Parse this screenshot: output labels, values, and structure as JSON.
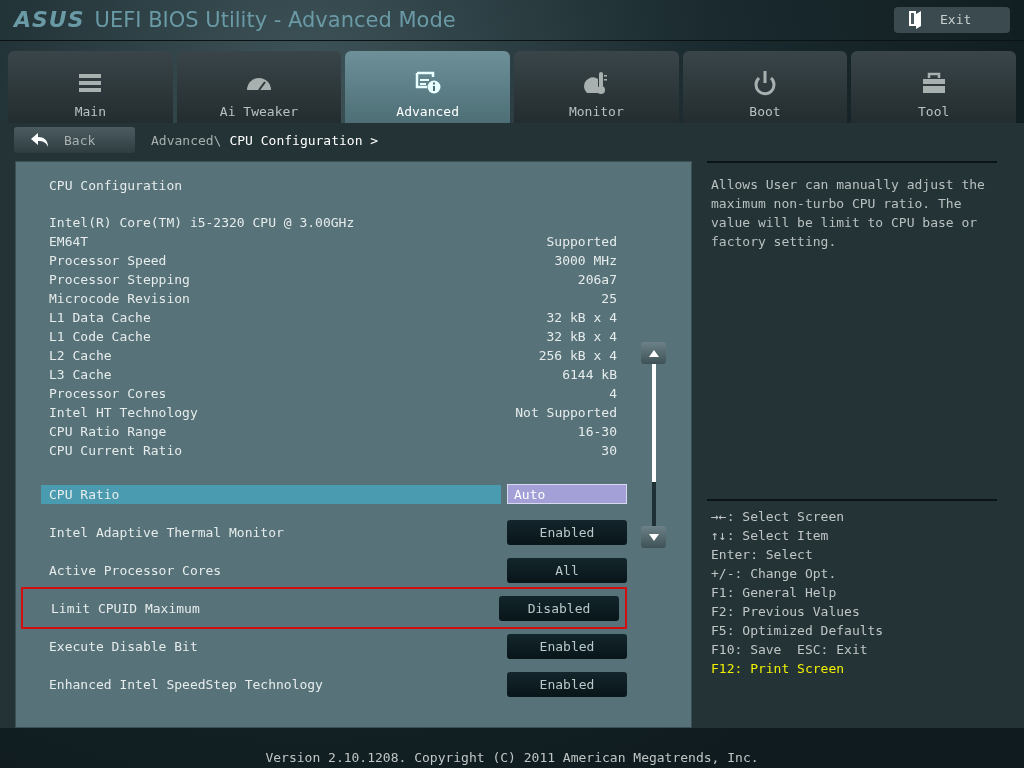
{
  "header": {
    "logo": "ASUS",
    "title": "UEFI BIOS Utility - Advanced Mode",
    "exit_button": "Exit"
  },
  "tabs": [
    {
      "label": "Main",
      "selected": false
    },
    {
      "label": "Ai Tweaker",
      "selected": false
    },
    {
      "label": "Advanced",
      "selected": true
    },
    {
      "label": "Monitor",
      "selected": false
    },
    {
      "label": "Boot",
      "selected": false
    },
    {
      "label": "Tool",
      "selected": false
    }
  ],
  "back_button": "Back",
  "breadcrumb": {
    "parent": "Advanced\\",
    "current": "CPU Configuration >"
  },
  "section_title": "CPU Configuration",
  "processor": "Intel(R) Core(TM) i5-2320 CPU @ 3.00GHz",
  "info_rows": [
    {
      "label": "EM64T",
      "value": "Supported"
    },
    {
      "label": "Processor Speed",
      "value": "3000 MHz"
    },
    {
      "label": "Processor Stepping",
      "value": "206a7"
    },
    {
      "label": "Microcode Revision",
      "value": "25"
    },
    {
      "label": "L1 Data Cache",
      "value": "32 kB x 4"
    },
    {
      "label": "L1 Code Cache",
      "value": "32 kB x 4"
    },
    {
      "label": "L2 Cache",
      "value": "256 kB x 4"
    },
    {
      "label": "L3 Cache",
      "value": "6144 kB"
    },
    {
      "label": "Processor Cores",
      "value": "4"
    },
    {
      "label": "Intel HT Technology",
      "value": "Not Supported"
    },
    {
      "label": "CPU Ratio Range",
      "value": "16-30"
    },
    {
      "label": "CPU Current Ratio",
      "value": "30"
    }
  ],
  "settings": [
    {
      "label": "CPU Ratio",
      "value": "Auto",
      "selected": true,
      "highlighted": false
    },
    {
      "label": "Intel Adaptive Thermal Monitor",
      "value": "Enabled",
      "selected": false,
      "highlighted": false
    },
    {
      "label": "Active Processor Cores",
      "value": "All",
      "selected": false,
      "highlighted": false
    },
    {
      "label": "Limit CPUID Maximum",
      "value": "Disabled",
      "selected": false,
      "highlighted": true
    },
    {
      "label": "Execute Disable Bit",
      "value": "Enabled",
      "selected": false,
      "highlighted": false
    },
    {
      "label": "Enhanced Intel SpeedStep Technology",
      "value": "Enabled",
      "selected": false,
      "highlighted": false
    }
  ],
  "help_text": "Allows User can manually adjust the maximum non-turbo CPU ratio. The value will be limit to CPU base or factory setting.",
  "key_help": [
    {
      "text": "→←: Select Screen",
      "emphasized": false
    },
    {
      "text": "↑↓: Select Item",
      "emphasized": false
    },
    {
      "text": "Enter: Select",
      "emphasized": false
    },
    {
      "text": "+/-: Change Opt.",
      "emphasized": false
    },
    {
      "text": "F1: General Help",
      "emphasized": false
    },
    {
      "text": "F2: Previous Values",
      "emphasized": false
    },
    {
      "text": "F5: Optimized Defaults",
      "emphasized": false
    },
    {
      "text": "F10: Save  ESC: Exit",
      "emphasized": false
    },
    {
      "text": "F12: Print Screen",
      "emphasized": true
    }
  ],
  "footer": "Version 2.10.1208. Copyright (C) 2011 American Megatrends, Inc."
}
